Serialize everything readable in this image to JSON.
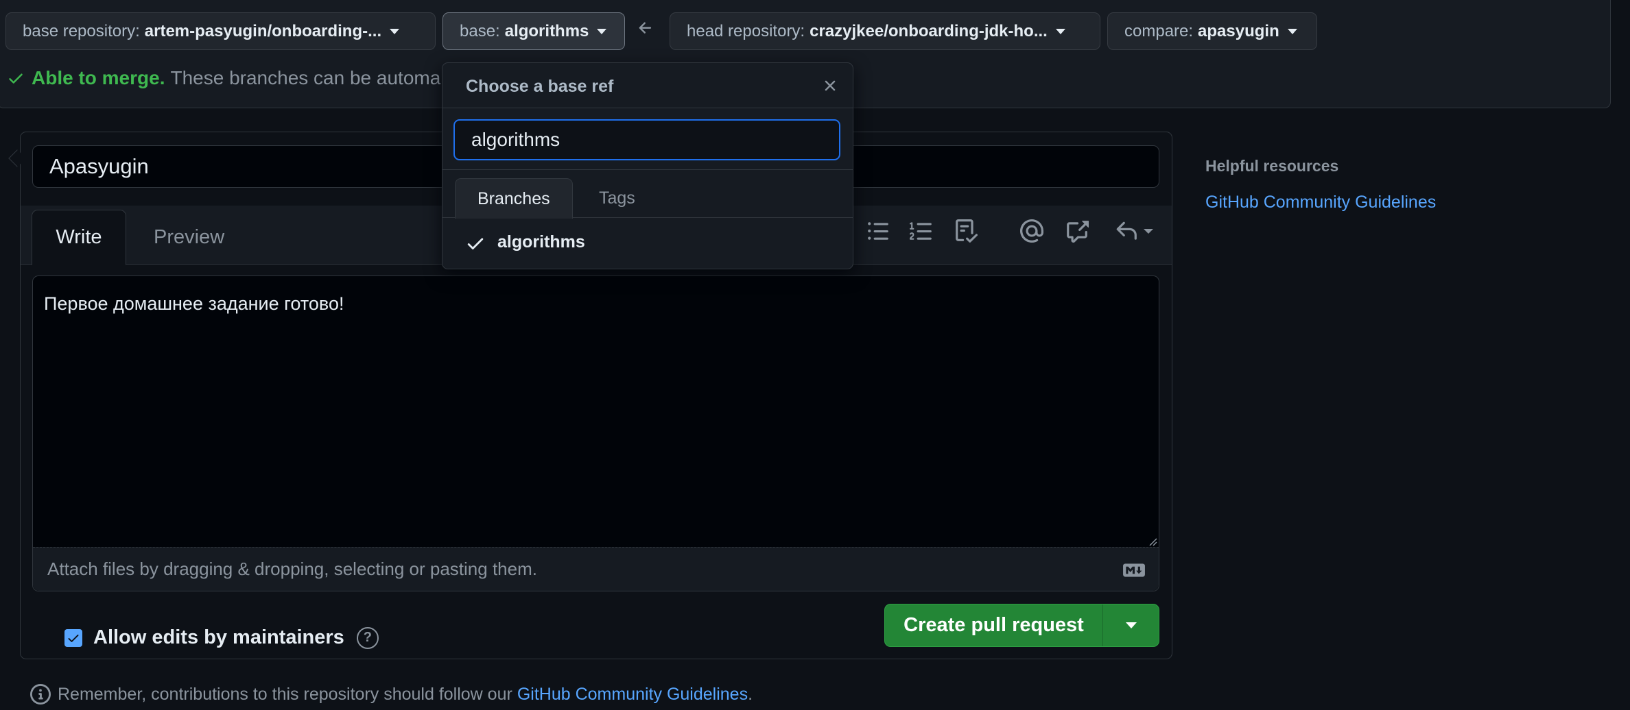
{
  "compare_bar": {
    "base_repository": {
      "label": "base repository:",
      "value": "artem-pasyugin/onboarding-..."
    },
    "base": {
      "label": "base:",
      "value": "algorithms"
    },
    "head_repository": {
      "label": "head repository:",
      "value": "crazyjkee/onboarding-jdk-ho..."
    },
    "compare": {
      "label": "compare:",
      "value": "apasyugin"
    },
    "merge_status": {
      "strong": "Able to merge.",
      "text": "These branches can be automa"
    }
  },
  "dropdown": {
    "title": "Choose a base ref",
    "filter_value": "algorithms",
    "tabs": [
      "Branches",
      "Tags"
    ],
    "items": [
      {
        "label": "algorithms",
        "selected": true
      }
    ]
  },
  "form": {
    "title_value": "Apasyugin",
    "tabs": {
      "write": "Write",
      "preview": "Preview"
    },
    "body_value": "Первое домашнее задание готово!",
    "attach_hint": "Attach files by dragging & dropping, selecting or pasting them.",
    "allow_edits_label": "Allow edits by maintainers",
    "allow_edits_checked": true,
    "help_glyph": "?",
    "create_button": "Create pull request"
  },
  "footer": {
    "remember_text": "Remember, contributions to this repository should follow our",
    "link_text": "GitHub Community Guidelines",
    "period": "."
  },
  "sidebar": {
    "heading": "Helpful resources",
    "link": "GitHub Community Guidelines"
  },
  "colors": {
    "background": "#0d1117",
    "accent_blue": "#58a6ff",
    "success_green": "#3fb950",
    "button_green": "#238636"
  }
}
